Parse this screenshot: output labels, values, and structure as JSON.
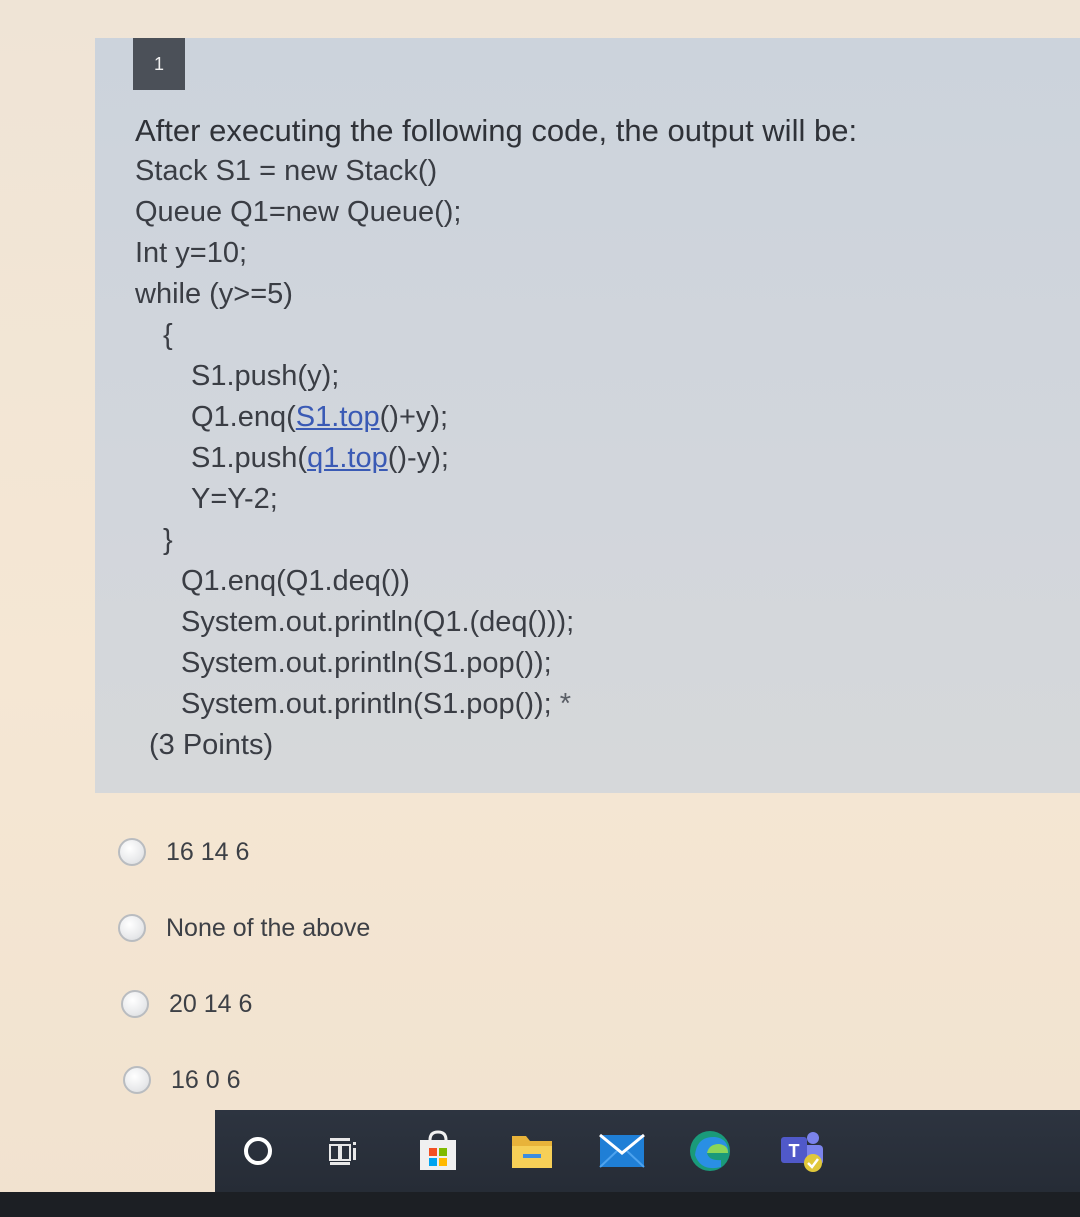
{
  "question": {
    "number": "1",
    "title": "After executing the following code, the output will be:",
    "code_lines": [
      "Stack S1 = new Stack()",
      "Queue Q1=new Queue();",
      "Int y=10;",
      "while (y>=5)",
      "{",
      "S1.push(y);",
      "Q1.enq(",
      "S1.top",
      "()+y);",
      "S1.push(",
      "q1.top",
      "()-y);",
      "Y=Y-2;",
      "}",
      "Q1.enq(Q1.deq())",
      "System.out.println(Q1.(deq()));",
      "System.out.println(S1.pop());",
      "System.out.println(S1.pop());"
    ],
    "required_marker": "*",
    "points": "(3 Points)"
  },
  "options": [
    {
      "label": "16 14 6"
    },
    {
      "label": "None of the above"
    },
    {
      "label": "20 14 6"
    },
    {
      "label": "16 0 6"
    }
  ],
  "taskbar": {
    "icons": [
      "search-icon",
      "task-view-icon",
      "store-icon",
      "file-explorer-icon",
      "mail-icon",
      "edge-icon",
      "teams-icon"
    ]
  },
  "colors": {
    "card": "#d0d5dc",
    "number_badge": "#4b5058",
    "link": "#3a5ab5",
    "taskbar": "#2a303a"
  }
}
